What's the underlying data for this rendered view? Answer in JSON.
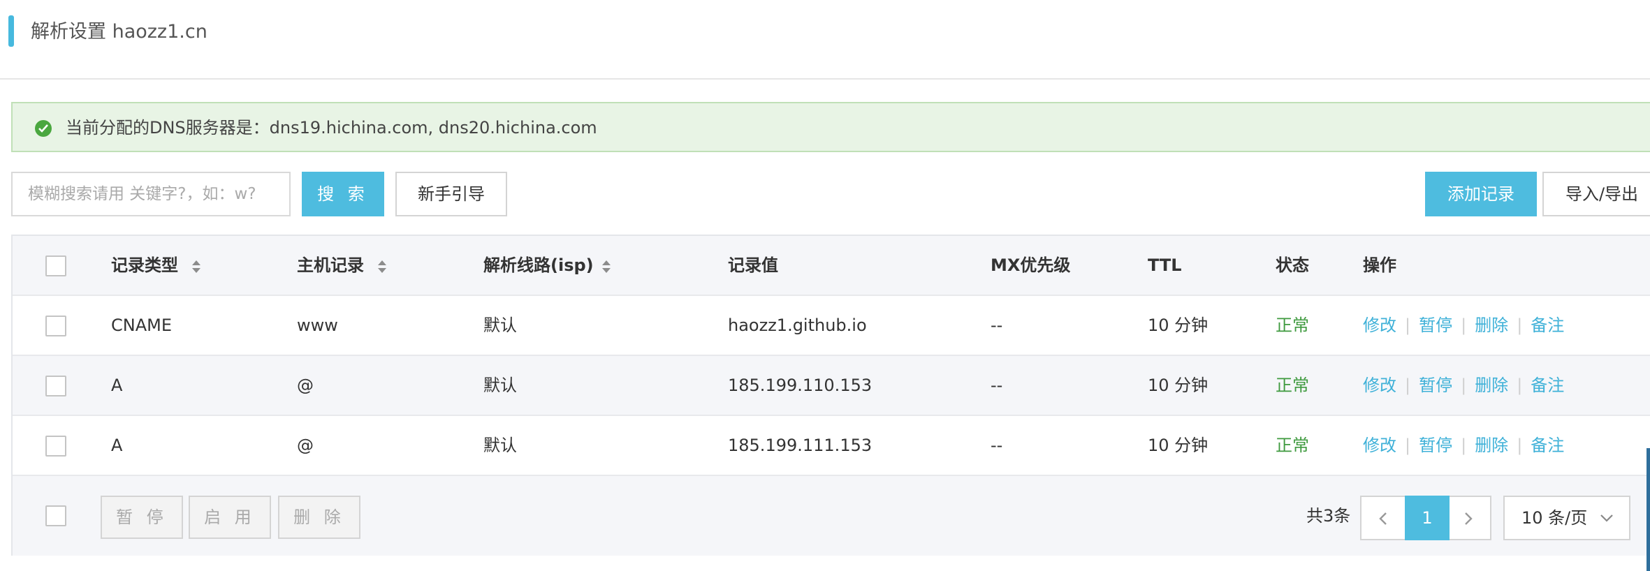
{
  "header": {
    "title": "解析设置 haozz1.cn"
  },
  "notice": {
    "text": "当前分配的DNS服务器是：dns19.hichina.com, dns20.hichina.com"
  },
  "toolbar": {
    "search_placeholder": "模糊搜索请用 关键字?，如：w?",
    "search_label": "搜 索",
    "guide_label": "新手引导",
    "add_label": "添加记录",
    "import_export_label": "导入/导出"
  },
  "table": {
    "headers": {
      "type": "记录类型",
      "host": "主机记录",
      "line": "解析线路(isp)",
      "value": "记录值",
      "mx": "MX优先级",
      "ttl": "TTL",
      "status": "状态",
      "ops": "操作"
    },
    "rows": [
      {
        "type": "CNAME",
        "host": "www",
        "line": "默认",
        "value": "haozz1.github.io",
        "mx": "--",
        "ttl": "10 分钟",
        "status": "正常"
      },
      {
        "type": "A",
        "host": "@",
        "line": "默认",
        "value": "185.199.110.153",
        "mx": "--",
        "ttl": "10 分钟",
        "status": "正常"
      },
      {
        "type": "A",
        "host": "@",
        "line": "默认",
        "value": "185.199.111.153",
        "mx": "--",
        "ttl": "10 分钟",
        "status": "正常"
      }
    ],
    "row_actions": {
      "edit": "修改",
      "pause": "暂停",
      "delete": "删除",
      "note": "备注"
    }
  },
  "footer": {
    "pause_label": "暂 停",
    "enable_label": "启 用",
    "delete_label": "删 除",
    "total_text": "共3条",
    "current_page": "1",
    "page_size": "10 条/页"
  },
  "colors": {
    "accent": "#4ebcdf",
    "link": "#3fb1d8",
    "success": "#3f9a3f",
    "notice_bg": "#e8f4e5"
  }
}
